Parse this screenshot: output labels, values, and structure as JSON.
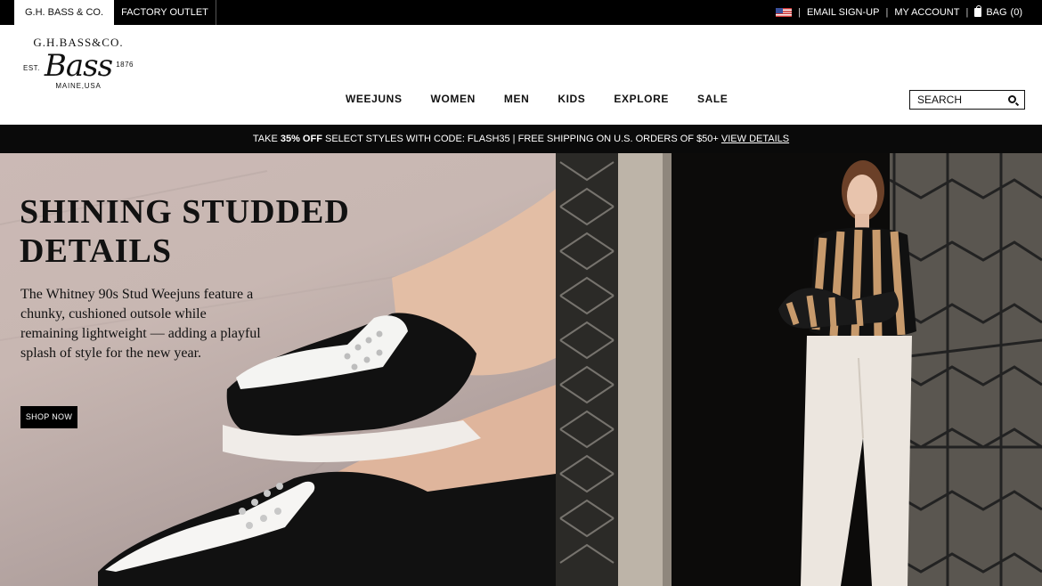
{
  "topbar": {
    "tabs": [
      {
        "label": "G.H. BASS & CO."
      },
      {
        "label": "FACTORY OUTLET"
      }
    ],
    "email_signup": "EMAIL SIGN-UP",
    "my_account": "MY ACCOUNT",
    "bag_label": "BAG",
    "bag_count": "(0)",
    "separator": "|"
  },
  "logo": {
    "top": "G.H.BASS&CO.",
    "script": "Bass",
    "est": "EST.",
    "year": "1876",
    "bottom": "MAINE,USA"
  },
  "nav": {
    "items": [
      "WEEJUNS",
      "WOMEN",
      "MEN",
      "KIDS",
      "EXPLORE",
      "SALE"
    ]
  },
  "search": {
    "placeholder": "SEARCH"
  },
  "promo": {
    "prefix": "TAKE ",
    "bold": "35% OFF",
    "text": " SELECT STYLES WITH CODE: FLASH35 | FREE SHIPPING ON U.S. ORDERS OF $50+ ",
    "link": "VIEW DETAILS"
  },
  "hero": {
    "title": "SHINING STUDDED DETAILS",
    "copy": "The Whitney 90s Stud Weejuns feature a chunky, cushioned outsole while remaining lightweight — adding a playful splash of style for the new year.",
    "cta": "SHOP NOW"
  },
  "colors": {
    "topbar_bg": "#000000",
    "promo_bg": "#0a0a0a",
    "accent": "#111111"
  }
}
